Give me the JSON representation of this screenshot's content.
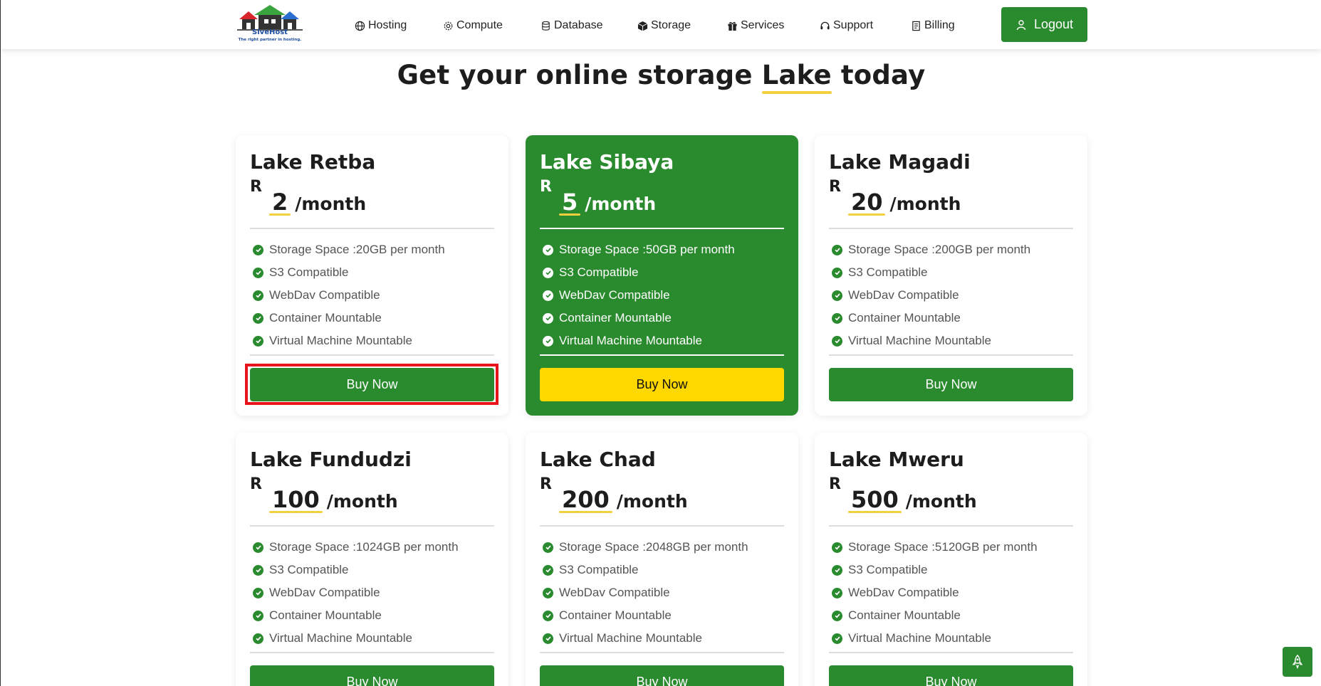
{
  "brand": {
    "name": "SiveHost",
    "tagline": "The right partner in hosting."
  },
  "nav": [
    {
      "label": "Hosting",
      "icon": "globe-icon"
    },
    {
      "label": "Compute",
      "icon": "gear-icon"
    },
    {
      "label": "Database",
      "icon": "database-icon"
    },
    {
      "label": "Storage",
      "icon": "box-icon"
    },
    {
      "label": "Services",
      "icon": "gift-icon"
    },
    {
      "label": "Support",
      "icon": "headset-icon"
    },
    {
      "label": "Billing",
      "icon": "receipt-icon"
    }
  ],
  "logout_label": "Logout",
  "headline": {
    "before": "Get your online storage ",
    "highlight": "Lake",
    "after": " today"
  },
  "currency": "R",
  "per_label": "/month",
  "buy_label": "Buy Now",
  "plans": [
    {
      "name": "Lake Retba",
      "price": "2",
      "features": [
        "Storage Space :20GB per month",
        "S3 Compatible",
        "WebDav Compatible",
        "Container Mountable",
        "Virtual Machine Mountable"
      ]
    },
    {
      "name": "Lake Sibaya",
      "price": "5",
      "features": [
        "Storage Space :50GB per month",
        "S3 Compatible",
        "WebDav Compatible",
        "Container Mountable",
        "Virtual Machine Mountable"
      ]
    },
    {
      "name": "Lake Magadi",
      "price": "20",
      "features": [
        "Storage Space :200GB per month",
        "S3 Compatible",
        "WebDav Compatible",
        "Container Mountable",
        "Virtual Machine Mountable"
      ]
    },
    {
      "name": "Lake Fundudzi",
      "price": "100",
      "features": [
        "Storage Space :1024GB per month",
        "S3 Compatible",
        "WebDav Compatible",
        "Container Mountable",
        "Virtual Machine Mountable"
      ]
    },
    {
      "name": "Lake Chad",
      "price": "200",
      "features": [
        "Storage Space :2048GB per month",
        "S3 Compatible",
        "WebDav Compatible",
        "Container Mountable",
        "Virtual Machine Mountable"
      ]
    },
    {
      "name": "Lake Mweru",
      "price": "500",
      "features": [
        "Storage Space :5120GB per month",
        "S3 Compatible",
        "WebDav Compatible",
        "Container Mountable",
        "Virtual Machine Mountable"
      ]
    }
  ],
  "colors": {
    "primary": "#2a8a2e",
    "accent": "#ffd800",
    "underline": "#f4d03f",
    "highlight_border": "#e8141b"
  },
  "fab_icon": "rocket-icon"
}
